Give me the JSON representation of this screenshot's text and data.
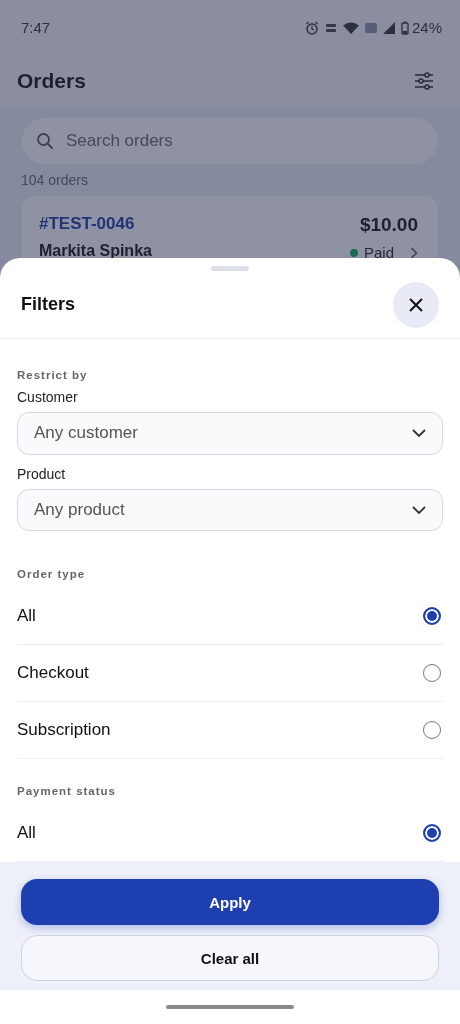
{
  "status_bar": {
    "time": "7:47",
    "battery": "24%"
  },
  "header": {
    "title": "Orders"
  },
  "search": {
    "placeholder": "Search orders"
  },
  "order_count": "104 orders",
  "orders": [
    {
      "id": "#TEST-0046",
      "customer": "Markita Spinka",
      "amount": "$10.00",
      "status": "Paid",
      "color": "#1c6a58"
    }
  ],
  "sheet": {
    "title": "Filters",
    "sections": [
      {
        "kind": "selects",
        "heading": "Restrict by",
        "fields": [
          {
            "label": "Customer",
            "value": "Any customer"
          },
          {
            "label": "Product",
            "value": "Any product"
          }
        ]
      },
      {
        "kind": "radios",
        "heading": "Order type",
        "options": [
          {
            "label": "All",
            "selected": true
          },
          {
            "label": "Checkout",
            "selected": false
          },
          {
            "label": "Subscription",
            "selected": false
          }
        ]
      },
      {
        "kind": "radios",
        "heading": "Payment status",
        "options": [
          {
            "label": "All",
            "selected": true
          }
        ]
      }
    ],
    "buttons": [
      {
        "label": "Apply",
        "kind": "primary"
      },
      {
        "label": "Clear all",
        "kind": "secondary"
      }
    ]
  }
}
